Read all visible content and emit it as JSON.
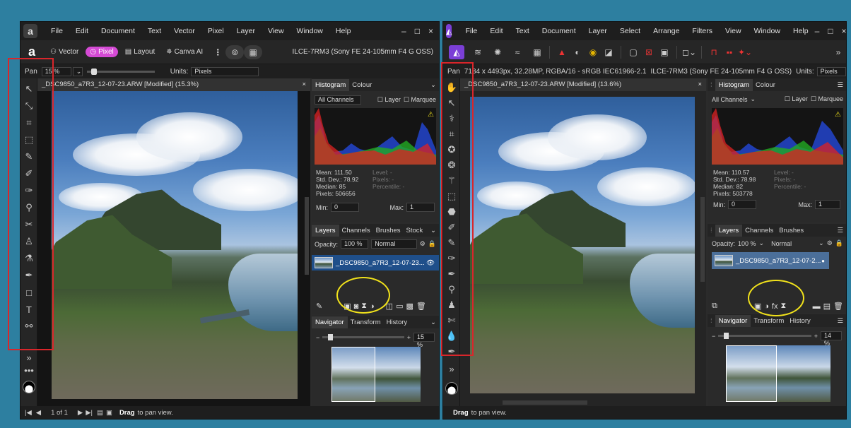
{
  "colors": {
    "background": "#2d7fa0",
    "affinity_v2_accent": "#d54ad5",
    "affinity_v1_accent": "#7b3fd6",
    "highlight_red": "#d9262b",
    "highlight_yellow": "#f1e21b",
    "layer_selected": "#1f4f8a"
  },
  "left": {
    "logo": "a",
    "menu": [
      "File",
      "Edit",
      "Document",
      "Text",
      "Vector",
      "Pixel",
      "Layer",
      "View",
      "Window",
      "Help"
    ],
    "window_controls": [
      "–",
      "□",
      "×"
    ],
    "personas": [
      "Vector",
      "Pixel",
      "Layout",
      "Canva AI"
    ],
    "camera": "ILCE-7RM3 (Sony FE 24-105mm F4 G OSS)",
    "ctx": {
      "tool": "Pan",
      "zoom": "15 %",
      "units_label": "Units:",
      "units_value": "Pixels"
    },
    "doc_title": "_DSC9850_a7R3_12-07-23.ARW [Modified] (15.3%)",
    "histogram_tabs": [
      "Histogram",
      "Colour"
    ],
    "channel": "All Channels",
    "layer_check": "Layer",
    "marquee_check": "Marquee",
    "stats": [
      "Mean: 111.50",
      "Std. Dev.: 78.92",
      "Median: 85",
      "Pixels: 506656"
    ],
    "stats_right": [
      "Level: -",
      "Pixels: -",
      "Percentile: -"
    ],
    "min_label": "Min:",
    "min_value": "0",
    "max_label": "Max:",
    "max_value": "1",
    "layer_tabs": [
      "Layers",
      "Channels",
      "Brushes",
      "Stock"
    ],
    "opacity_label": "Opacity:",
    "opacity_value": "100 %",
    "blend_mode": "Normal",
    "layer_name": "_DSC9850_a7R3_12-07-23...",
    "nav_tabs": [
      "Navigator",
      "Transform",
      "History"
    ],
    "nav_zoom": "15 %",
    "status_page": "1 of 1",
    "status_hint_bold": "Drag",
    "status_hint": "to pan view."
  },
  "right": {
    "menu": [
      "File",
      "Edit",
      "Text",
      "Document",
      "Layer",
      "Select",
      "Arrange",
      "Filters",
      "View",
      "Window",
      "Help"
    ],
    "window_controls": [
      "–",
      "□",
      "×"
    ],
    "ctx": {
      "tool": "Pan",
      "info": "7184 x 4493px, 32.28MP, RGBA/16 - sRGB IEC61966-2.1",
      "camera": "ILCE-7RM3 (Sony FE 24-105mm F4 G OSS)",
      "units_label": "Units:",
      "units_value": "Pixels"
    },
    "doc_title": "_DSC9850_a7R3_12-07-23.ARW [Modified] (13.6%)",
    "histogram_tabs": [
      "Histogram",
      "Colour"
    ],
    "channel": "All Channels",
    "layer_check": "Layer",
    "marquee_check": "Marquee",
    "stats": [
      "Mean: 110.57",
      "Std. Dev.: 78.98",
      "Median: 82",
      "Pixels: 503778"
    ],
    "stats_right": [
      "Level: -",
      "Pixels: -",
      "Percentile: -"
    ],
    "min_label": "Min:",
    "min_value": "0",
    "max_label": "Max:",
    "max_value": "1",
    "layer_tabs": [
      "Layers",
      "Channels",
      "Brushes"
    ],
    "opacity_label": "Opacity:",
    "opacity_value": "100 %",
    "blend_mode": "Normal",
    "layer_name": "_DSC9850_a7R3_12-07-2...",
    "nav_tabs": [
      "Navigator",
      "Transform",
      "History"
    ],
    "nav_zoom": "14 %",
    "status_hint_bold": "Drag",
    "status_hint": "to pan view."
  }
}
